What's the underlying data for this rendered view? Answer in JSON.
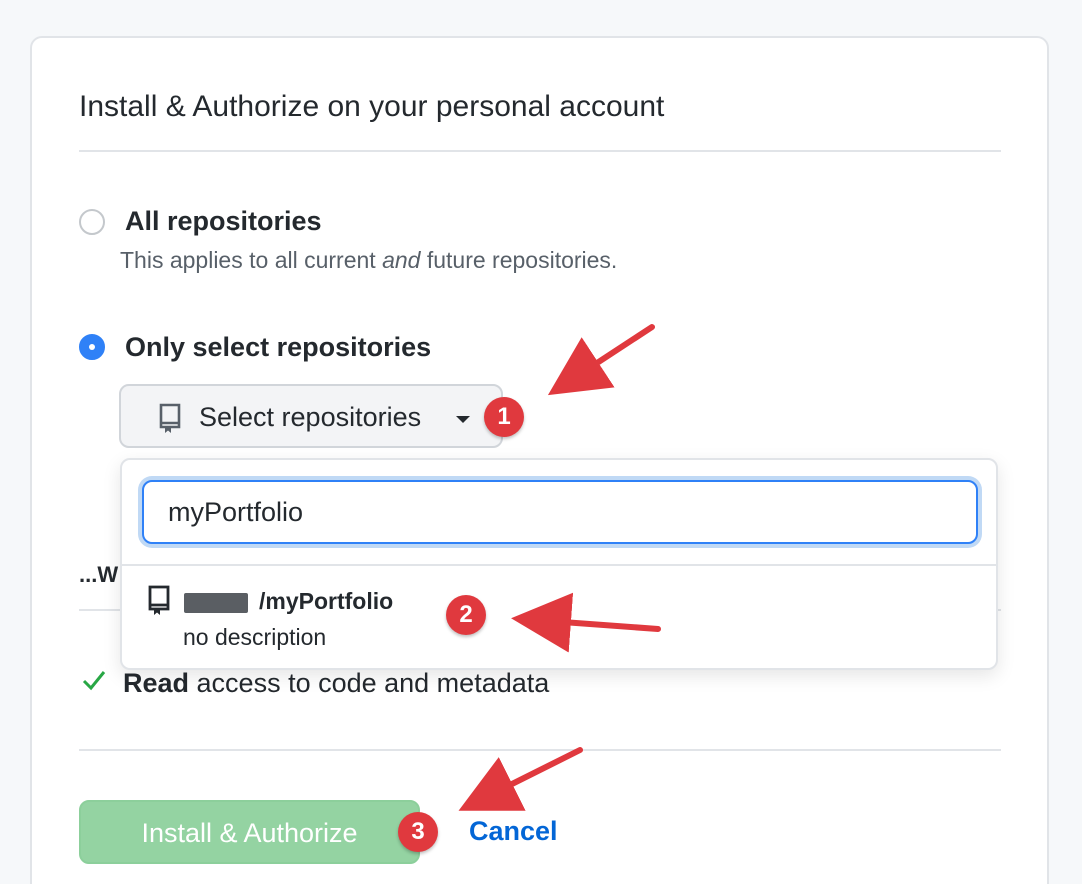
{
  "card": {
    "title": "Install & Authorize on your personal account"
  },
  "options": {
    "all": {
      "label": "All repositories",
      "note_prefix": "This applies to all current ",
      "note_em": "and",
      "note_suffix": " future repositories.",
      "selected": false
    },
    "select": {
      "label": "Only select repositories",
      "selected": true
    }
  },
  "select_button": {
    "label": "Select repositories",
    "icon": "repo-icon"
  },
  "dropdown": {
    "search_value": "myPortfolio",
    "results": [
      {
        "name": "/myPortfolio",
        "description": "no description",
        "icon": "repo-icon"
      }
    ]
  },
  "partially_hidden_text": "...W",
  "permissions": [
    {
      "icon": "check-icon",
      "bold": "Read",
      "rest": " access to code and metadata"
    }
  ],
  "actions": {
    "install_label": "Install & Authorize",
    "cancel_label": "Cancel"
  },
  "annotations": {
    "badges": [
      "1",
      "2",
      "3"
    ],
    "color": "#e0393e"
  },
  "colors": {
    "accent": "#2f81f7",
    "link": "#0366d6",
    "success_disabled": "#94d3a2",
    "check": "#28a745"
  }
}
